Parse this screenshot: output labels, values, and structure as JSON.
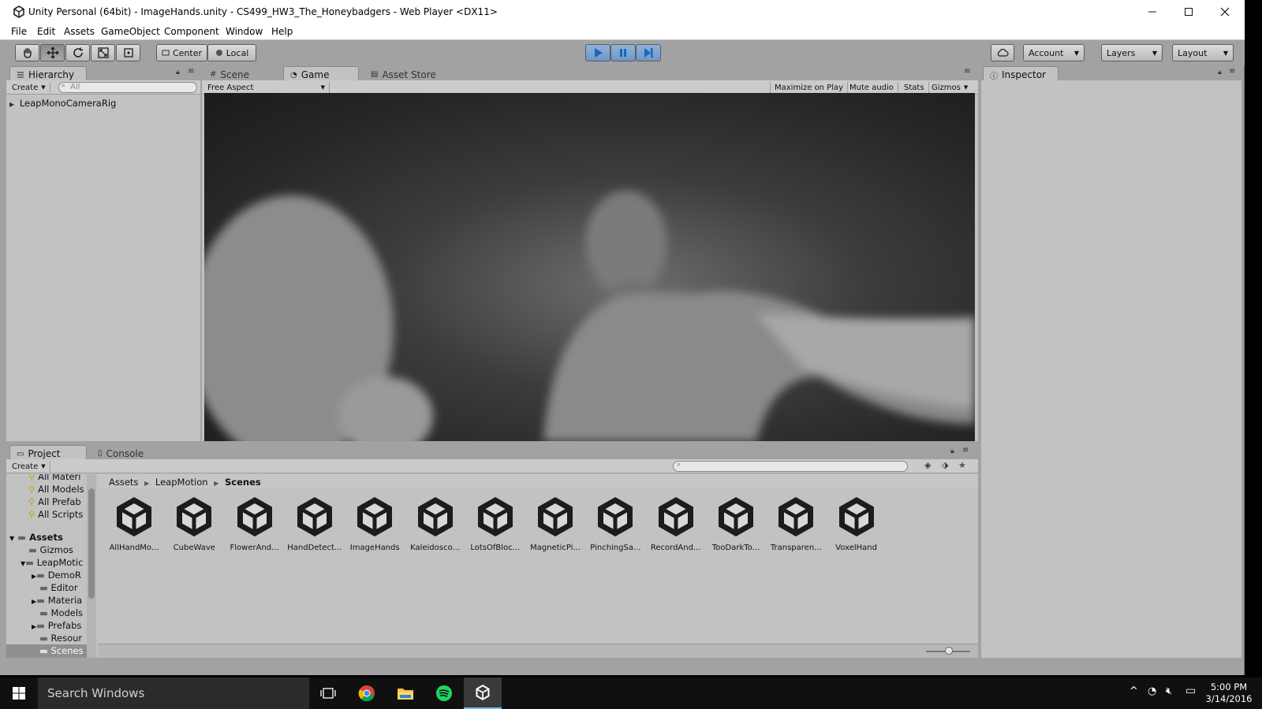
{
  "window": {
    "title": "Unity Personal (64bit) - ImageHands.unity - CS499_HW3_The_Honeybadgers - Web Player <DX11>"
  },
  "menu": [
    "File",
    "Edit",
    "Assets",
    "GameObject",
    "Component",
    "Window",
    "Help"
  ],
  "toolbar": {
    "pivot_label": "Center",
    "space_label": "Local",
    "account_label": "Account",
    "layers_label": "Layers",
    "layout_label": "Layout"
  },
  "hierarchy": {
    "tab": "Hierarchy",
    "create_label": "Create",
    "search_placeholder": "All",
    "items": [
      "LeapMonoCameraRig"
    ]
  },
  "center_tabs": {
    "scene": "Scene",
    "game": "Game",
    "asset_store": "Asset Store"
  },
  "game_bar": {
    "aspect": "Free Aspect",
    "maximize": "Maximize on Play",
    "mute": "Mute audio",
    "stats": "Stats",
    "gizmos": "Gizmos"
  },
  "inspector": {
    "tab": "Inspector"
  },
  "project": {
    "tab": "Project",
    "console_tab": "Console",
    "create_label": "Create",
    "favorites": [
      "All Materi",
      "All Models",
      "All Prefab",
      "All Scripts"
    ],
    "assets_root": "Assets",
    "tree": [
      "Gizmos",
      "LeapMotic",
      "DemoR",
      "Editor",
      "Materia",
      "Models",
      "Prefabs",
      "Resour",
      "Scenes"
    ],
    "breadcrumb": [
      "Assets",
      "LeapMotion",
      "Scenes"
    ],
    "scenes": [
      "AllHandMo...",
      "CubeWave",
      "FlowerAnd...",
      "HandDetect...",
      "ImageHands",
      "Kaleidosco...",
      "LotsOfBloc...",
      "MagneticPi...",
      "PinchingSa...",
      "RecordAnd...",
      "TooDarkTo...",
      "Transparen...",
      "VoxelHand"
    ]
  },
  "taskbar": {
    "search_placeholder": "Search Windows",
    "time": "5:00 PM",
    "date": "3/14/2016"
  },
  "colors": {
    "editor_bg": "#a2a2a2",
    "panel_bg": "#c2c2c2",
    "play_blue": "#2f7fd1",
    "taskbar": "#101010"
  }
}
